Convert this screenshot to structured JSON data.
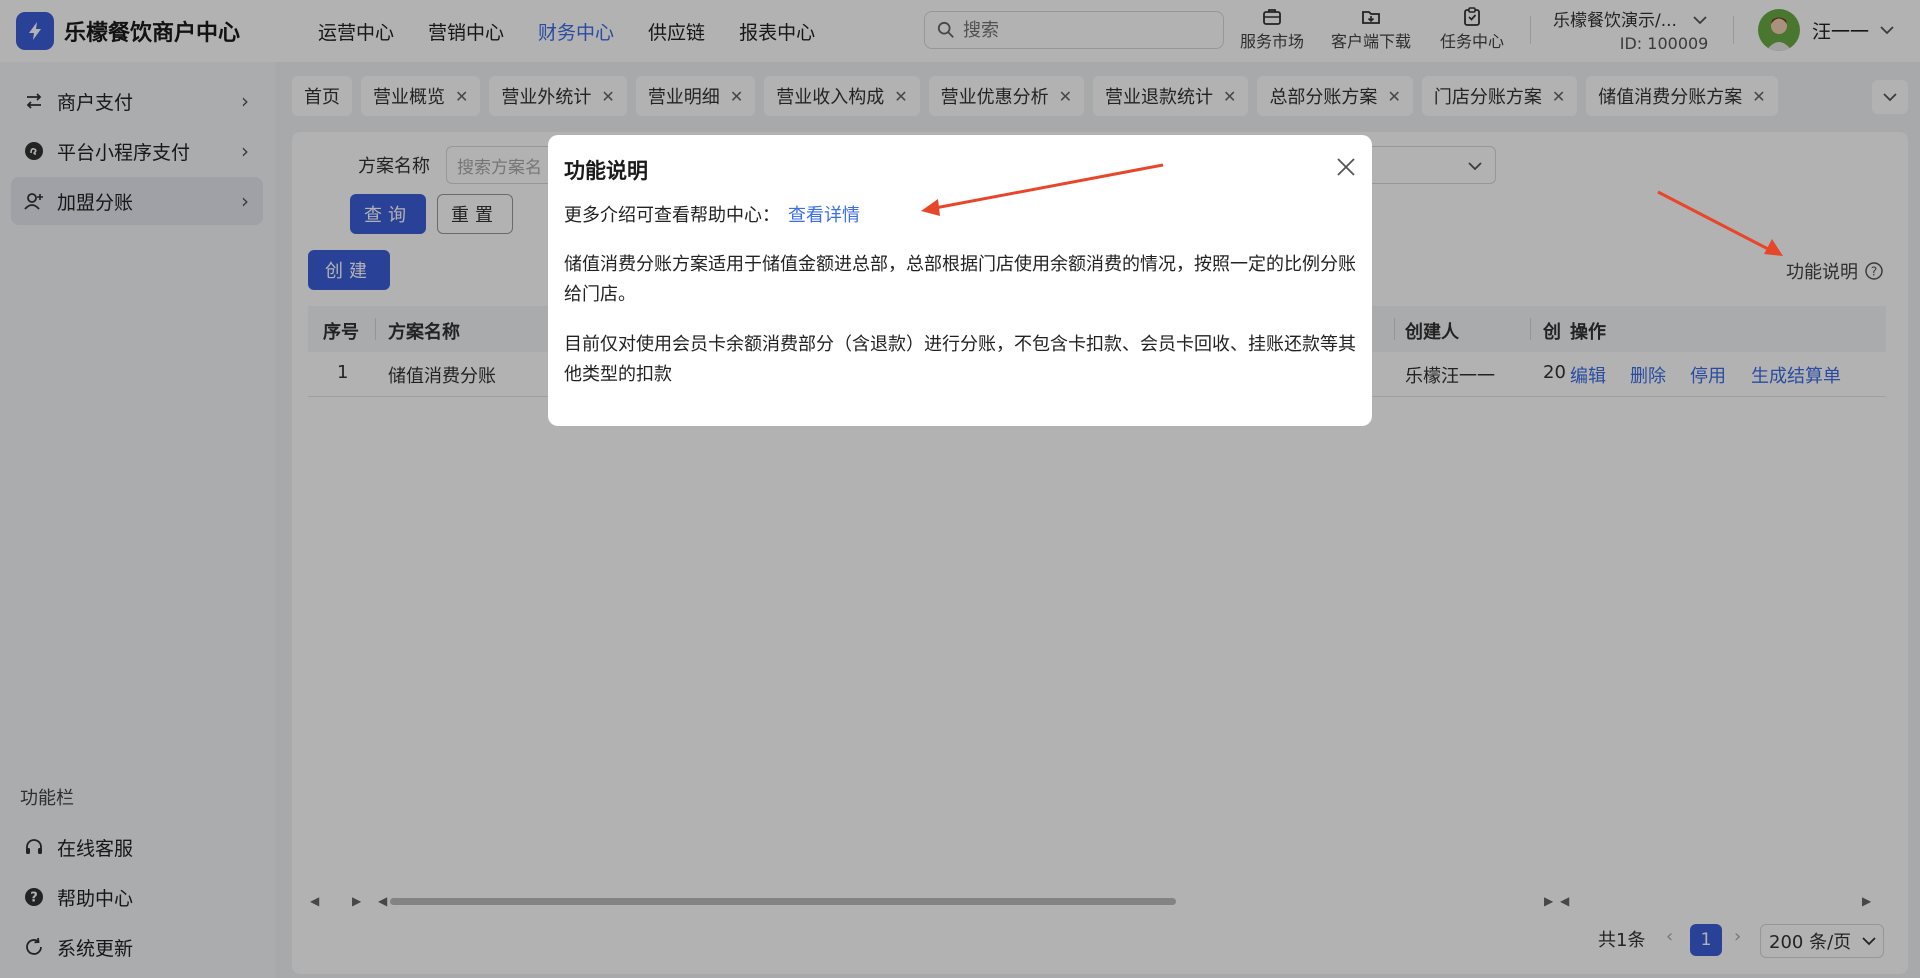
{
  "header": {
    "brand": "乐檬餐饮商户中心",
    "nav": [
      "运营中心",
      "营销中心",
      "财务中心",
      "供应链",
      "报表中心"
    ],
    "active_nav": "财务中心",
    "search_placeholder": "搜索",
    "tools": {
      "service_market": "服务市场",
      "client_download": "客户端下载",
      "task_center": "任务中心"
    },
    "merchant_name": "乐檬餐饮演示/...",
    "merchant_id": "ID: 100009",
    "user_name": "汪一一"
  },
  "sidebar": {
    "items": [
      "商户支付",
      "平台小程序支付",
      "加盟分账"
    ],
    "active": "加盟分账",
    "section_title": "功能栏",
    "bottom_items": [
      "在线客服",
      "帮助中心",
      "系统更新"
    ]
  },
  "tabs": [
    "首页",
    "营业概览",
    "营业外统计",
    "营业明细",
    "营业收入构成",
    "营业优惠分析",
    "营业退款统计",
    "总部分账方案",
    "门店分账方案",
    "储值消费分账方案"
  ],
  "filter": {
    "name_label": "方案名称",
    "name_placeholder": "搜索方案名",
    "query": "查询",
    "reset": "重置",
    "create": "创建"
  },
  "func_desc": "功能说明",
  "table": {
    "headers": {
      "index": "序号",
      "name": "方案名称",
      "creator": "创建人",
      "created_trunc": "创",
      "ops": "操作"
    },
    "row": {
      "index": "1",
      "name": "储值消费分账",
      "creator": "乐檬汪一一",
      "created_trunc": "20",
      "ops": [
        "编辑",
        "删除",
        "停用",
        "生成结算单"
      ]
    }
  },
  "pager": {
    "total": "共1条",
    "current": "1",
    "page_size": "200 条/页"
  },
  "modal": {
    "title": "功能说明",
    "help_prefix": "更多介绍可查看帮助中心：",
    "help_link": "查看详情",
    "para1": "储值消费分账方案适用于储值金额进总部，总部根据门店使用余额消费的情况，按照一定的比例分账给门店。",
    "para2": "目前仅对使用会员卡余额消费部分（含退款）进行分账，不包含卡扣款、会员卡回收、挂账还款等其他类型的扣款"
  },
  "colors": {
    "primary": "#3b5fd9",
    "link": "#3b6ee8",
    "annotation_arrow": "#e8462a"
  }
}
